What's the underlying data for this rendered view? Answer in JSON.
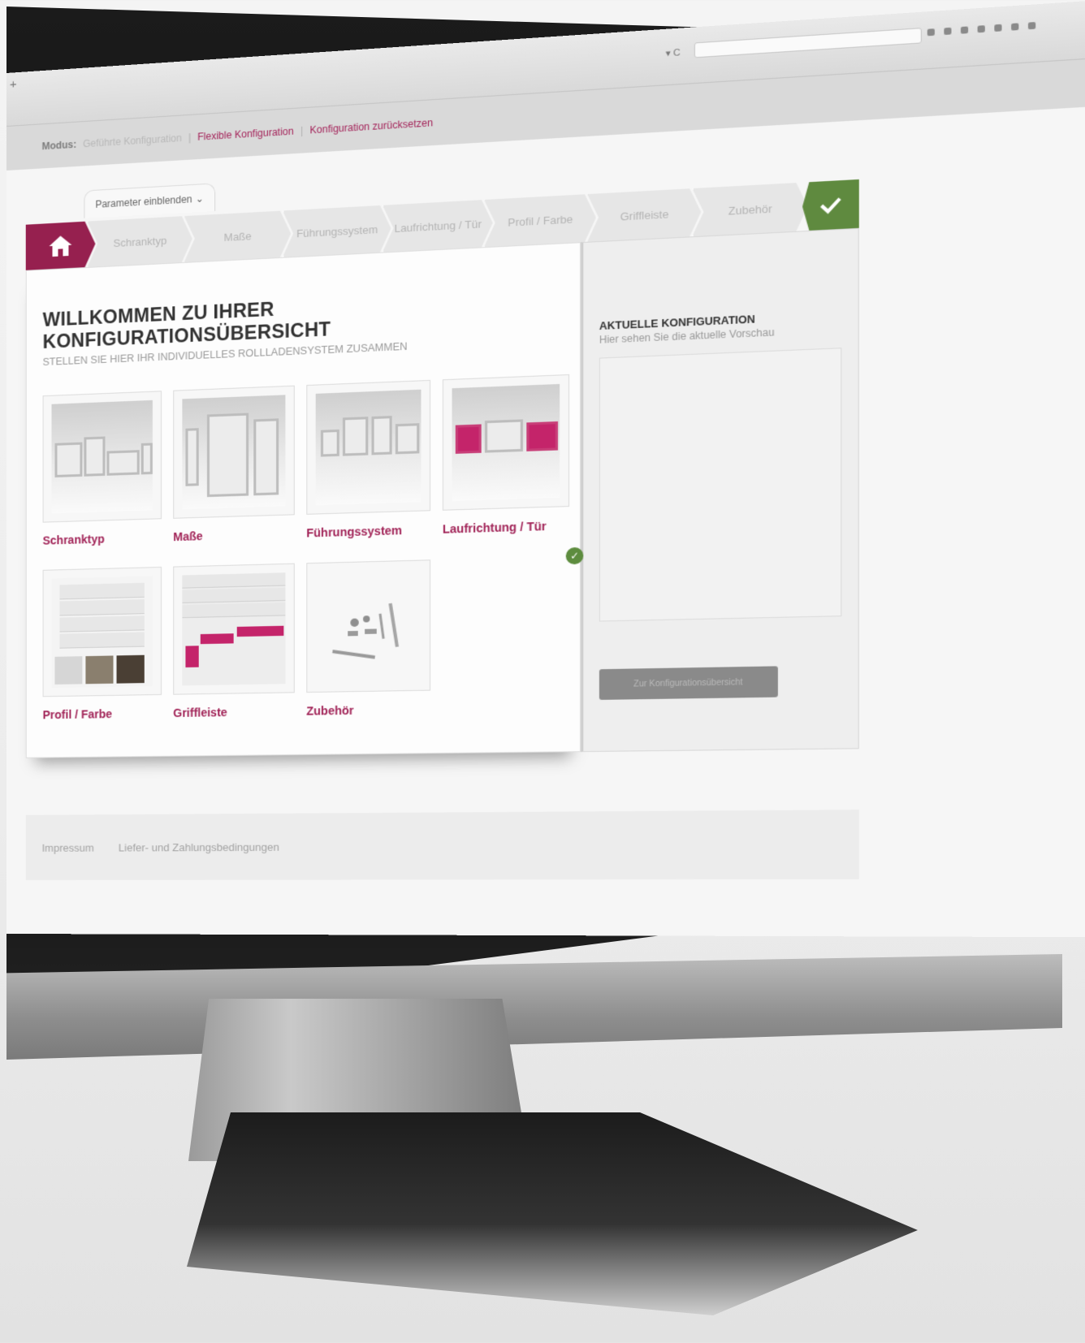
{
  "browser": {
    "new_tab_glyph": "+",
    "refresh_glyph": "▾ C"
  },
  "mode_bar": {
    "label": "Modus:",
    "guided": "Geführte Konfiguration",
    "flexible": "Flexible Konfiguration",
    "reset": "Konfiguration zurücksetzen",
    "separator": "|"
  },
  "param_toggle": "Parameter einblenden",
  "breadcrumb": {
    "home_icon": "home-icon",
    "steps": [
      "Schranktyp",
      "Maße",
      "Führungssystem",
      "Laufrichtung / Tür",
      "Profil / Farbe",
      "Griffleiste",
      "Zubehör"
    ],
    "done_icon": "check-icon"
  },
  "main": {
    "title": "WILLKOMMEN ZU IHRER KONFIGURATIONSÜBERSICHT",
    "subtitle": "STELLEN SIE HIER IHR INDIVIDUELLES ROLLLADENSYSTEM ZUSAMMEN",
    "tiles": [
      {
        "label": "Schranktyp",
        "checked": false
      },
      {
        "label": "Maße",
        "checked": false
      },
      {
        "label": "Führungssystem",
        "checked": false
      },
      {
        "label": "Laufrichtung / Tür",
        "checked": true
      },
      {
        "label": "Profil / Farbe",
        "checked": false
      },
      {
        "label": "Griffleiste",
        "checked": false
      },
      {
        "label": "Zubehör",
        "checked": false
      }
    ]
  },
  "side": {
    "title": "AKTUELLE KONFIGURATION",
    "subtitle": "Hier sehen Sie die aktuelle Vorschau",
    "button": "Zur Konfigurationsübersicht"
  },
  "footer": {
    "links": [
      "Impressum",
      "Liefer- und Zahlungsbedingungen"
    ]
  },
  "colors": {
    "brand": "#96204f",
    "accent_text": "#a12357",
    "done_green": "#5f8a3f"
  }
}
